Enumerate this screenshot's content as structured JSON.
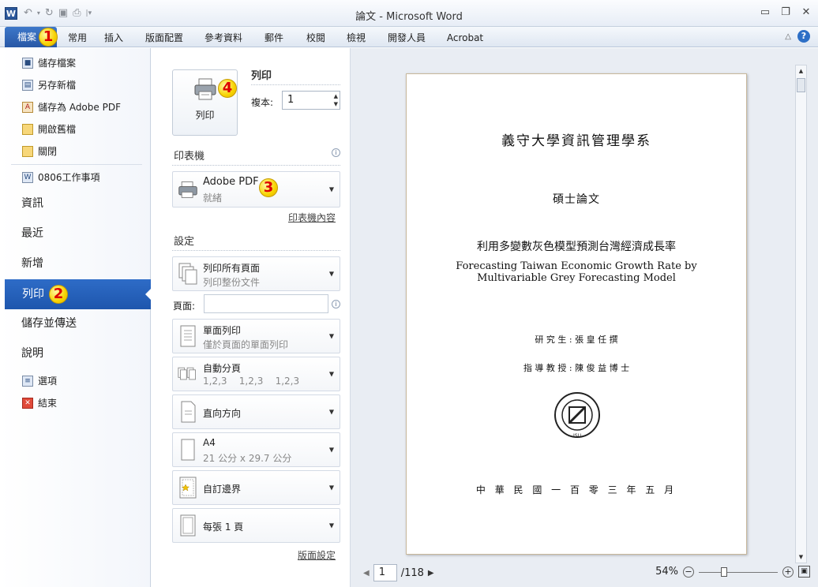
{
  "window": {
    "app_icon": "W",
    "title": "論文 - Microsoft Word",
    "controls": [
      "minimize-icon",
      "restore-icon",
      "close-icon"
    ]
  },
  "ribbon": {
    "tabs": [
      "檔案",
      "常用",
      "插入",
      "版面配置",
      "參考資料",
      "郵件",
      "校閱",
      "檢視",
      "開發人員",
      "Acrobat"
    ]
  },
  "badges": [
    "1",
    "2",
    "3",
    "4"
  ],
  "backstage": {
    "small_items": [
      "儲存檔案",
      "另存新檔",
      "儲存為 Adobe PDF",
      "開啟舊檔",
      "關閉"
    ],
    "recent_doc": "0806工作事項",
    "big_items": [
      "資訊",
      "最近",
      "新增",
      "列印",
      "儲存並傳送",
      "說明"
    ],
    "active_item": "列印",
    "bottom_items": [
      "選項",
      "結束"
    ]
  },
  "print": {
    "section_title": "列印",
    "button_label": "列印",
    "copies_label": "複本:",
    "copies_value": "1",
    "printer_heading": "印表機",
    "printer_name": "Adobe PDF",
    "printer_status": "就緒",
    "printer_props_link": "印表機內容",
    "settings_heading": "設定",
    "settings": [
      {
        "title": "列印所有頁面",
        "subtitle": "列印整份文件"
      },
      {
        "title": "單面列印",
        "subtitle": "僅於頁面的單面列印"
      },
      {
        "title": "自動分頁",
        "subtitle": "1,2,3    1,2,3    1,2,3"
      },
      {
        "title": "直向方向",
        "subtitle": ""
      },
      {
        "title": "A4",
        "subtitle": "21 公分 x 29.7 公分"
      },
      {
        "title": "自訂邊界",
        "subtitle": ""
      },
      {
        "title": "每張 1 頁",
        "subtitle": ""
      }
    ],
    "pages_label": "頁面:",
    "pages_value": "",
    "page_setup_link": "版面設定"
  },
  "preview": {
    "page": {
      "school": "義守大學資訊管理學系",
      "degree": "碩士論文",
      "title_zh": "利用多變數灰色模型預測台灣經濟成長率",
      "title_en_1": "Forecasting Taiwan Economic Growth Rate by",
      "title_en_2": "Multivariable Grey Forecasting Model",
      "student": "研 究 生 : 張 皇 任  撰",
      "advisor": "指 導 教 授 : 陳 俊 益 博 士",
      "seal": "ISU",
      "date": "中 華 民 國 一 百 零 三 年 五 月"
    },
    "current_page": "1",
    "total_pages": "/118",
    "zoom": "54%"
  }
}
